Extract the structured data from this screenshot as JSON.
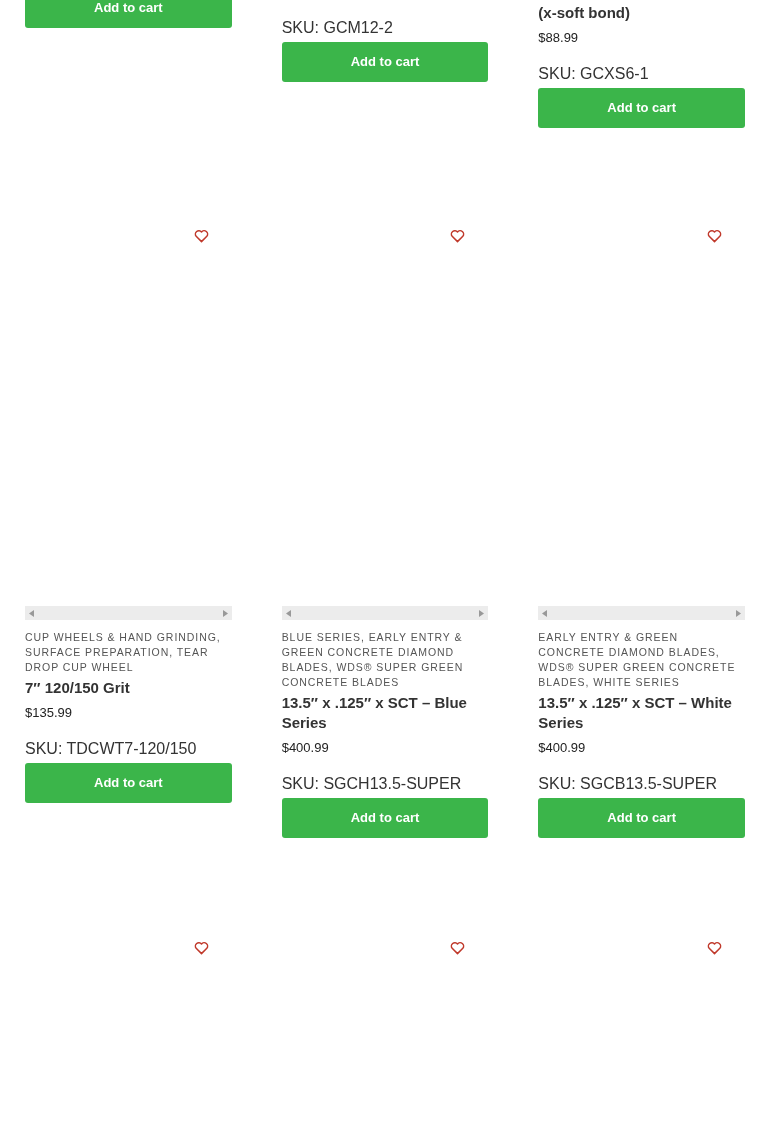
{
  "top_products": [
    {
      "button": "Add to cart"
    },
    {
      "sku": "SKU: GCM12-2",
      "button": "Add to cart"
    },
    {
      "title": "(x-soft bond)",
      "price": "$88.99",
      "sku": "SKU: GCXS6-1",
      "button": "Add to cart"
    }
  ],
  "products": [
    {
      "categories": "CUP WHEELS & HAND GRINDING, SURFACE PREPARATION, TEAR DROP CUP WHEEL",
      "title": "7″ 120/150 Grit",
      "price": "$135.99",
      "sku": "SKU: TDCWT7-120/150",
      "button": "Add to cart"
    },
    {
      "categories": "BLUE SERIES, EARLY ENTRY & GREEN CONCRETE DIAMOND BLADES, WDS® SUPER GREEN CONCRETE BLADES",
      "title": "13.5″ x .125″ x SCT – Blue Series",
      "price": "$400.99",
      "sku": "SKU: SGCH13.5-SUPER",
      "button": "Add to cart"
    },
    {
      "categories": "EARLY ENTRY & GREEN CONCRETE DIAMOND BLADES, WDS® SUPER GREEN CONCRETE BLADES, WHITE SERIES",
      "title": "13.5″ x .125″ x SCT – White Series",
      "price": "$400.99",
      "sku": "SKU: SGCB13.5-SUPER",
      "button": "Add to cart"
    }
  ],
  "next_products": [
    {
      "wishlisted": false
    },
    {
      "wishlisted": false
    },
    {
      "wishlisted": false
    }
  ]
}
